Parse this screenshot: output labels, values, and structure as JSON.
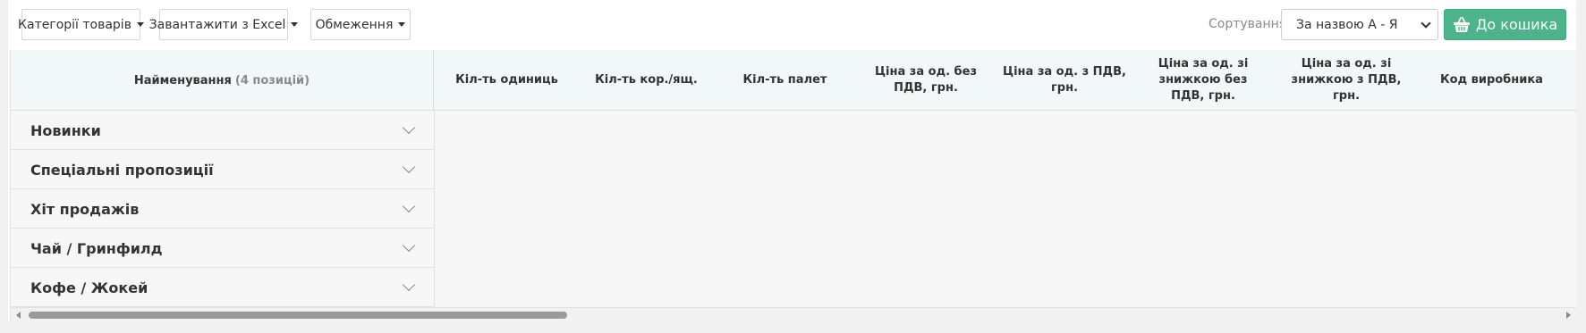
{
  "toolbar": {
    "categories_label": "Категорії товарів",
    "excel_label": "Завантажити з Excel",
    "limits_label": "Обмеження",
    "sort_label": "Сортування",
    "sort_selected": "За назвою А - Я",
    "cart_label": "До кошика"
  },
  "table": {
    "name_header": "Найменування",
    "name_count": "(4 позицій)",
    "columns": [
      "Кіл-ть одиниць",
      "Кіл-ть кор./ящ.",
      "Кіл-ть палет",
      "Ціна за од. без ПДВ, грн.",
      "Ціна за од. з ПДВ, грн.",
      "Ціна за од. зі знижкою без ПДВ, грн.",
      "Ціна за од. зі знижкою з ПДВ, грн.",
      "Код виробника"
    ],
    "groups": [
      "Новинки",
      "Спеціальні пропозиції",
      "Хіт продажів",
      "Чай / Гринфилд",
      "Кофе / Жокей"
    ]
  },
  "colors": {
    "accent": "#4cb38a",
    "header_bg": "#f2f8f7"
  }
}
